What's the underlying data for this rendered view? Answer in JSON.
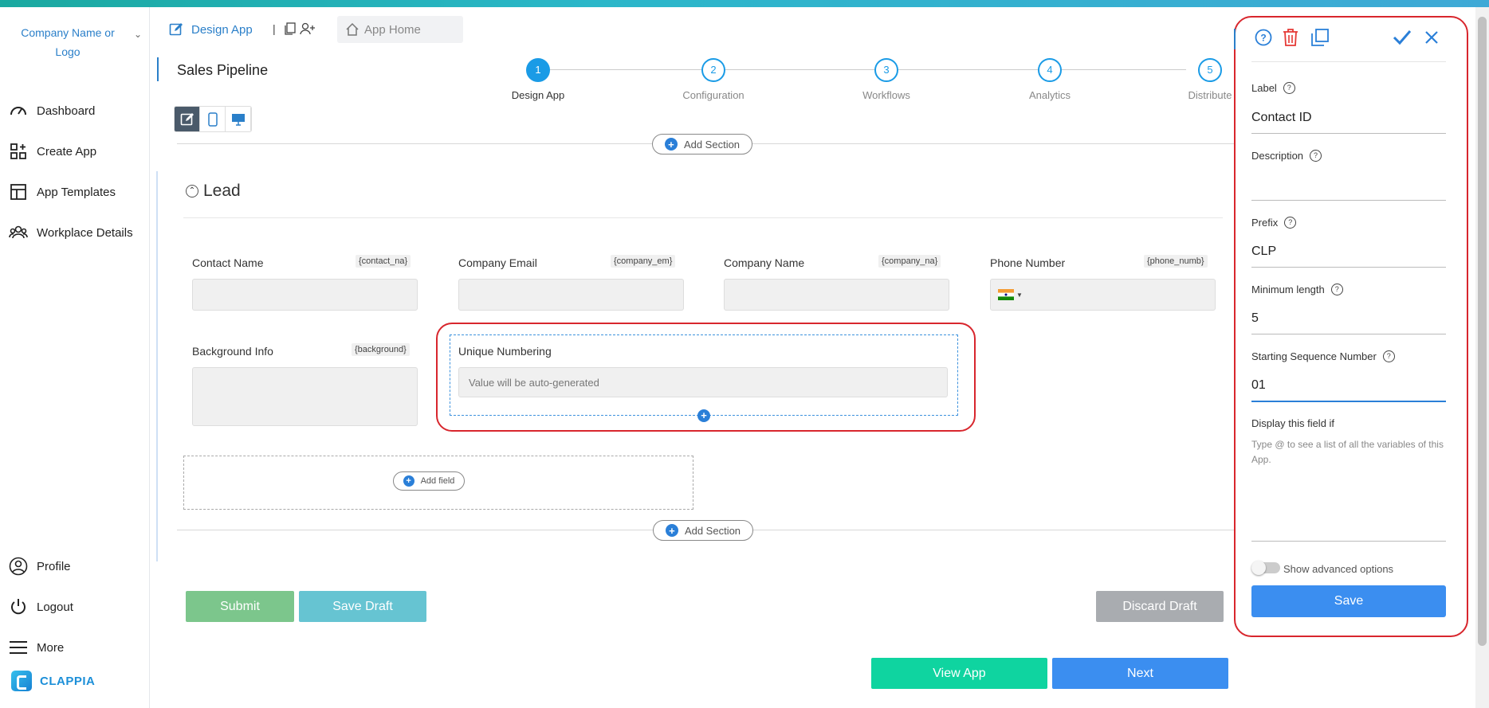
{
  "sidebar": {
    "brand": "Company Name or Logo",
    "items": [
      {
        "label": "Dashboard",
        "icon": "gauge-icon"
      },
      {
        "label": "Create App",
        "icon": "grid-plus-icon"
      },
      {
        "label": "App Templates",
        "icon": "template-icon"
      },
      {
        "label": "Workplace Details",
        "icon": "users-icon"
      }
    ],
    "bottom": [
      {
        "label": "Profile",
        "icon": "user-circle-icon"
      },
      {
        "label": "Logout",
        "icon": "power-icon"
      },
      {
        "label": "More",
        "icon": "menu-icon"
      }
    ],
    "product": "CLAPPIA"
  },
  "tabs": {
    "design": "Design App",
    "home": "App Home"
  },
  "page_title": "Sales Pipeline",
  "steps": [
    {
      "num": "1",
      "label": "Design App"
    },
    {
      "num": "2",
      "label": "Configuration"
    },
    {
      "num": "3",
      "label": "Workflows"
    },
    {
      "num": "4",
      "label": "Analytics"
    },
    {
      "num": "5",
      "label": "Distribute"
    }
  ],
  "add_section": "Add Section",
  "section_title": "Lead",
  "fields": [
    {
      "label": "Contact Name",
      "var": "{contact_na}"
    },
    {
      "label": "Company Email",
      "var": "{company_em}"
    },
    {
      "label": "Company Name",
      "var": "{company_na}"
    },
    {
      "label": "Phone Number",
      "var": "{phone_numb}"
    },
    {
      "label": "Background Info",
      "var": "{background}"
    }
  ],
  "unique": {
    "label": "Unique Numbering",
    "placeholder": "Value will be auto-generated"
  },
  "add_field": "Add field",
  "buttons": {
    "submit": "Submit",
    "save_draft": "Save Draft",
    "discard_draft": "Discard Draft",
    "view_app": "View App",
    "next": "Next"
  },
  "panel": {
    "label_title": "Label",
    "label_value": "Contact ID",
    "description_title": "Description",
    "description_value": "",
    "prefix_title": "Prefix",
    "prefix_value": "CLP",
    "min_length_title": "Minimum length",
    "min_length_value": "5",
    "start_seq_title": "Starting Sequence Number",
    "start_seq_value": "01",
    "display_if_title": "Display this field if",
    "display_if_hint": "Type @ to see a list of all the variables of this App.",
    "advanced": "Show advanced options",
    "save": "Save"
  },
  "colors": {
    "accent": "#2a7fd8",
    "submit": "#7cc68c",
    "save_draft": "#66c4d2",
    "discard": "#a9acb0",
    "view_app": "#0fd4a0",
    "next": "#3b8ef0",
    "highlight": "#d8262d"
  }
}
